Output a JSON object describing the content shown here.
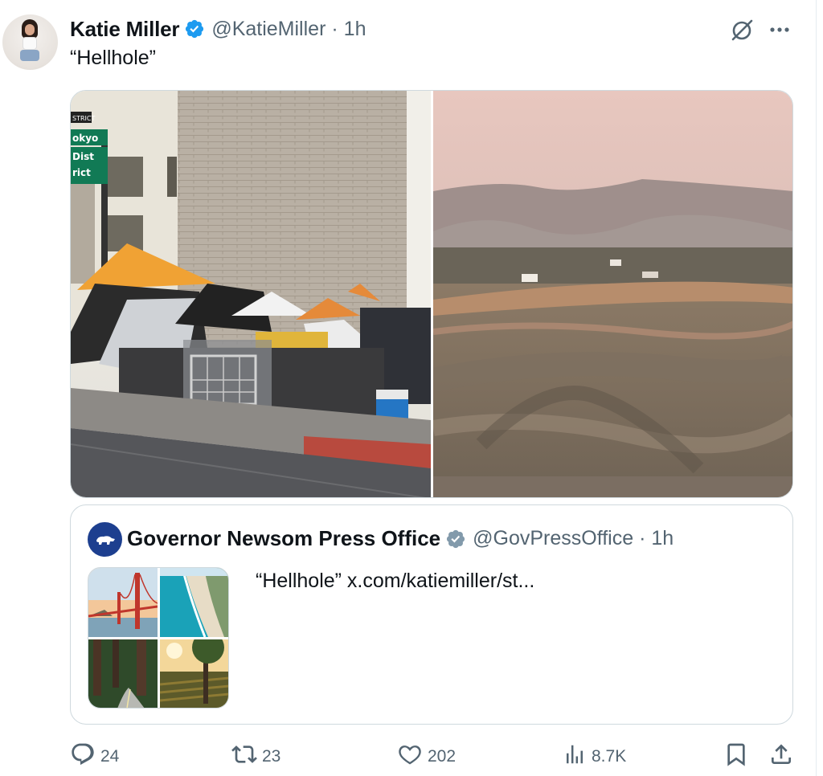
{
  "tweet": {
    "author_name": "Katie Miller",
    "author_handle": "@KatieMiller",
    "time": "· 1h",
    "text": "“Hellhole”",
    "verified_color": "#1d9bf0",
    "icons": [
      "grok-icon",
      "more-icon",
      "verified-badge-icon"
    ],
    "media": [
      {
        "name": "encampment-photo"
      },
      {
        "name": "burned-hillside-photo"
      }
    ],
    "street_sign": {
      "line1": "STRICT",
      "line2": "okyo",
      "line3": "Dist",
      "line4": "rict"
    }
  },
  "quote": {
    "author_name": "Governor Newsom Press Office",
    "author_handle": "@GovPressOffice",
    "time": "· 1h",
    "text": "“Hellhole”  x.com/katiemiller/st...",
    "verified_color": "#829aab",
    "avatar_color": "#1d3f8f",
    "grid_images": [
      "golden-gate-bridge",
      "coastline-beach",
      "redwood-road",
      "sunset-vineyard"
    ]
  },
  "actions": {
    "reply_count": "24",
    "repost_count": "23",
    "like_count": "202",
    "views_count": "8.7K"
  },
  "colors": {
    "text_secondary": "#536471",
    "border": "#cfd9de"
  }
}
